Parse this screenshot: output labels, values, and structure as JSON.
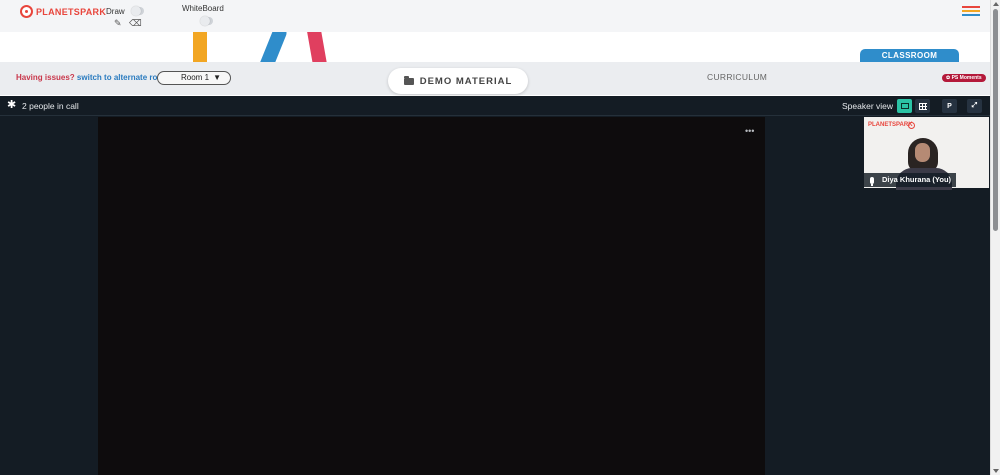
{
  "topbar": {
    "logo_text": "PLANETSPARK",
    "draw_label": "Draw",
    "whiteboard_label": "WhiteBoard",
    "menu_colors": [
      "#e8453c",
      "#f2a623",
      "#2f8dcb",
      "#3bb273"
    ]
  },
  "strip": {
    "issues_text": "Having issues?",
    "switch_link": "switch to alternate room",
    "room_value": "Room 1",
    "demo_material_label": "DEMO MATERIAL",
    "curriculum_label": "CURRICULUM",
    "classroom_tab": "CLASSROOM",
    "moments_badge": "PS Moments"
  },
  "call": {
    "people_count_text": "2 people in call",
    "view_label": "Speaker view",
    "pin_button": "P",
    "participant_name": "Diya Khurana (You)",
    "thumb_logo": "PLANETSPARK"
  },
  "colors": {
    "brand_red": "#e8453c",
    "accent_blue": "#2f8dcb",
    "call_bg": "#141c24",
    "active_view": "#2bc3a5"
  }
}
